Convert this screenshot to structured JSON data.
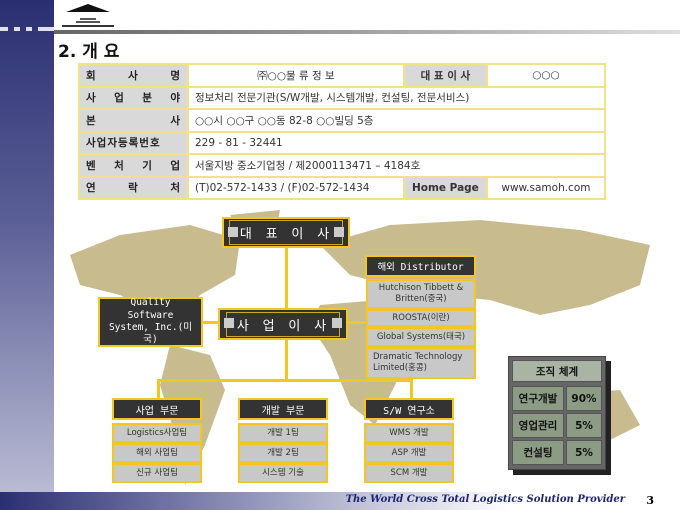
{
  "section_title": "2. 개 요",
  "table": {
    "company_label": "회 사 명",
    "company": "㈜○○물 류 정 보",
    "ceo_label": "대 표 이 사",
    "ceo": "○○○",
    "business_label": "사 업 분 야",
    "business": "정보처리 전문기관(S/W개발, 시스템개발, 컨설팅, 전문서비스)",
    "hq_label": "본 사",
    "hq": "○○시 ○○구 ○○동 82-8 ○○빌딩 5층",
    "regno_label": "사업자등록번호",
    "regno": "229 - 81 - 32441",
    "venture_label": "벤 처 기 업",
    "venture": "서울지방 중소기업청 / 제2000113471 – 4184호",
    "contact_label": "연 락 처",
    "contact": "(T)02-572-1433 / (F)02-572-1434",
    "homepage_label": "Home Page",
    "homepage": "www.samoh.com"
  },
  "org": {
    "ceo": "대 표 이 사",
    "bizdir": "사 업 이 사",
    "partner": "Quality Software System, Inc.(미국)",
    "distributor_title": "해외 Distributor",
    "distributors": [
      "Hutchison Tibbett & Britten(중국)",
      "ROOSTA(이란)",
      "Global Systems(태국)",
      "Dramatic Technology Limited(홍콩)"
    ],
    "departments": [
      {
        "name": "사업 부문",
        "teams": [
          "Logistics사업팀",
          "해외 사업팀",
          "신규 사업팀"
        ]
      },
      {
        "name": "개발 부문",
        "teams": [
          "개발 1팀",
          "개발 2팀",
          "시스템 기술"
        ]
      },
      {
        "name": "S/W 연구소",
        "teams": [
          "WMS 개발",
          "ASP 개발",
          "SCM 개발"
        ]
      }
    ]
  },
  "structure": {
    "title": "조직 체계",
    "rows": [
      {
        "name": "연구개발",
        "pct": "90%"
      },
      {
        "name": "영업관리",
        "pct": "5%"
      },
      {
        "name": "컨설팅",
        "pct": "5%"
      }
    ]
  },
  "footer": {
    "slogan": "The World Cross Total Logistics Solution Provider",
    "page": "3"
  }
}
